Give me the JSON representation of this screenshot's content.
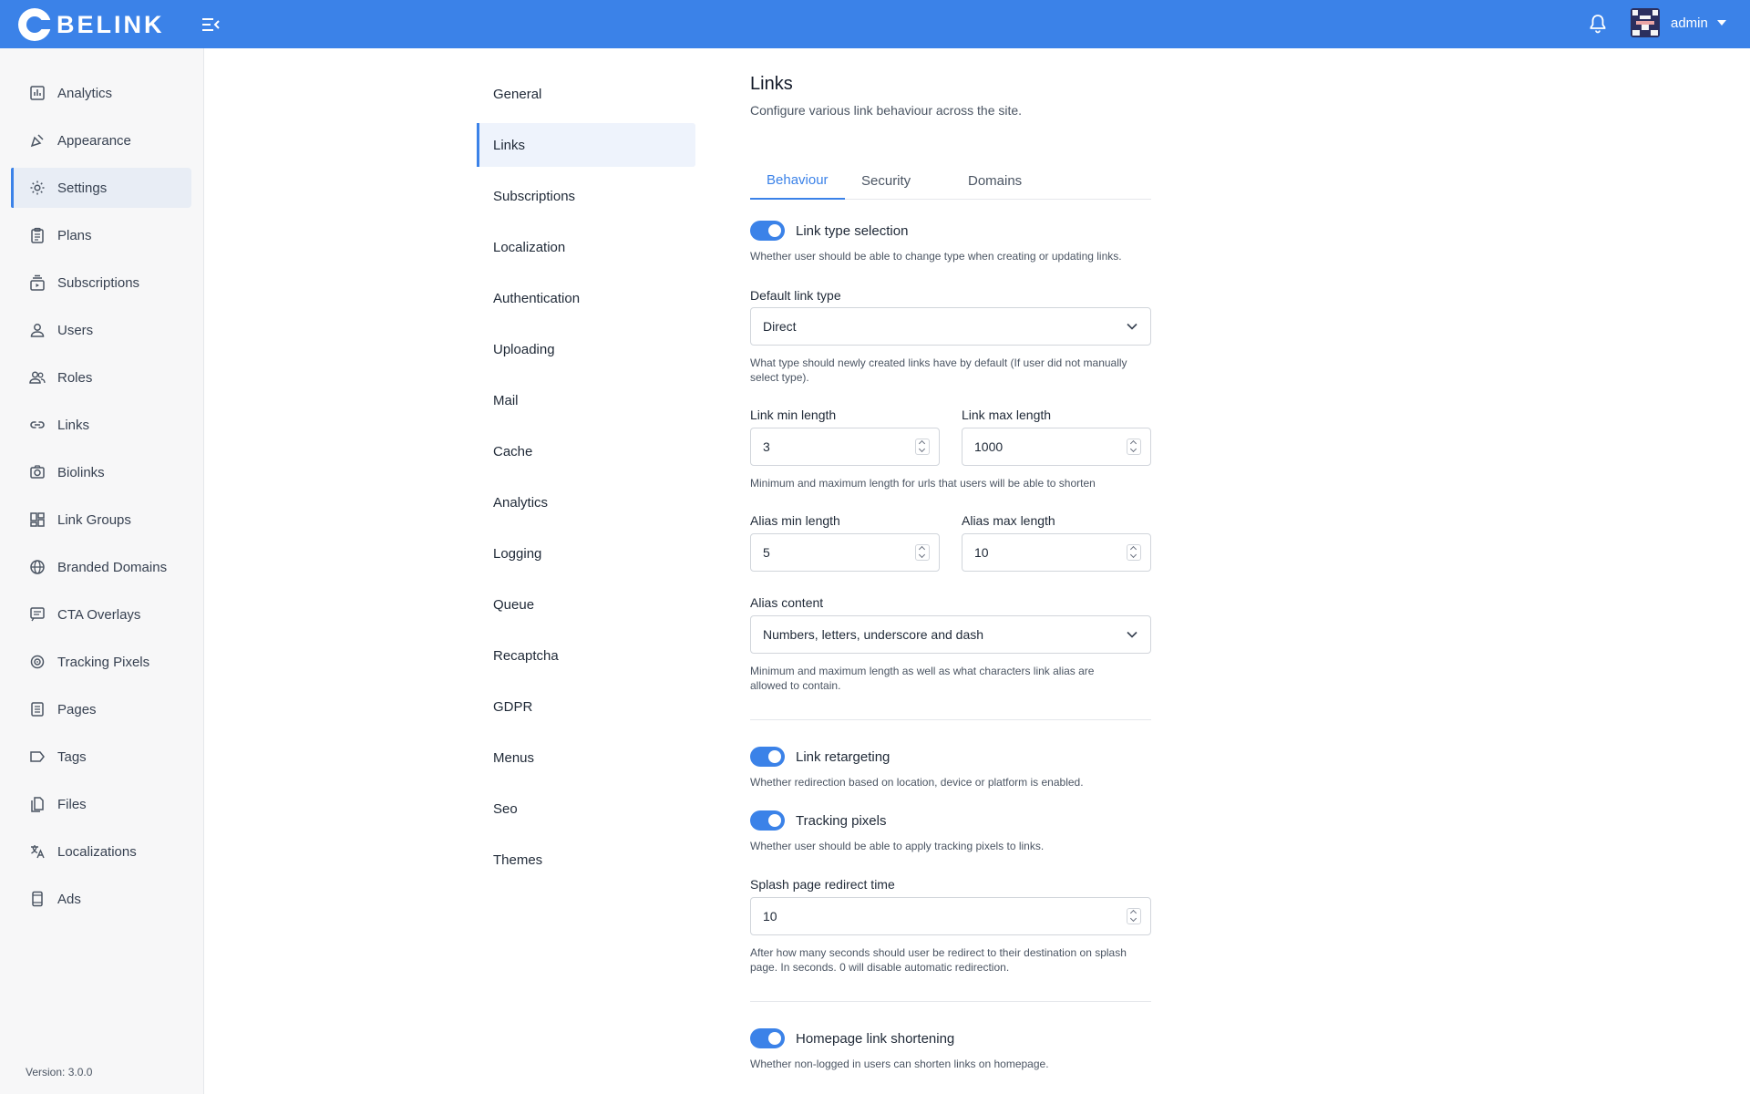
{
  "brand": {
    "name": "BELINK"
  },
  "topbar": {
    "user_name": "admin",
    "icons": [
      "menu-toggle-icon",
      "bell-icon",
      "avatar"
    ]
  },
  "sidebar": {
    "items": [
      {
        "label": "Analytics",
        "icon": "analytics-icon"
      },
      {
        "label": "Appearance",
        "icon": "appearance-icon"
      },
      {
        "label": "Settings",
        "icon": "gear-icon",
        "active": true
      },
      {
        "label": "Plans",
        "icon": "clipboard-icon"
      },
      {
        "label": "Subscriptions",
        "icon": "subscriptions-icon"
      },
      {
        "label": "Users",
        "icon": "user-icon"
      },
      {
        "label": "Roles",
        "icon": "people-icon"
      },
      {
        "label": "Links",
        "icon": "link-icon"
      },
      {
        "label": "Biolinks",
        "icon": "biolinks-icon"
      },
      {
        "label": "Link Groups",
        "icon": "dashboard-icon"
      },
      {
        "label": "Branded Domains",
        "icon": "globe-icon"
      },
      {
        "label": "CTA Overlays",
        "icon": "overlay-icon"
      },
      {
        "label": "Tracking Pixels",
        "icon": "pixel-icon"
      },
      {
        "label": "Pages",
        "icon": "pages-icon"
      },
      {
        "label": "Tags",
        "icon": "tag-icon"
      },
      {
        "label": "Files",
        "icon": "files-icon"
      },
      {
        "label": "Localizations",
        "icon": "translate-icon"
      },
      {
        "label": "Ads",
        "icon": "ads-icon"
      }
    ],
    "version": "Version: 3.0.0"
  },
  "settings_nav": {
    "items": [
      "General",
      "Links",
      "Subscriptions",
      "Localization",
      "Authentication",
      "Uploading",
      "Mail",
      "Cache",
      "Analytics",
      "Logging",
      "Queue",
      "Recaptcha",
      "GDPR",
      "Menus",
      "Seo",
      "Themes"
    ],
    "active": "Links"
  },
  "main": {
    "title": "Links",
    "subtitle": "Configure various link behaviour across the site.",
    "tabs": [
      "Behaviour",
      "Security",
      "Domains"
    ],
    "active_tab": "Behaviour",
    "link_type_selection": {
      "label": "Link type selection",
      "enabled": true,
      "hint": "Whether user should be able to change type when creating or updating links."
    },
    "default_link_type": {
      "label": "Default link type",
      "value": "Direct",
      "hint": "What type should newly created links have by default (If user did not manually select type)."
    },
    "link_min_length": {
      "label": "Link min length",
      "value": "3"
    },
    "link_max_length": {
      "label": "Link max length",
      "value": "1000"
    },
    "link_length_hint": "Minimum and maximum length for urls that users will be able to shorten",
    "alias_min_length": {
      "label": "Alias min length",
      "value": "5"
    },
    "alias_max_length": {
      "label": "Alias max length",
      "value": "10"
    },
    "alias_content": {
      "label": "Alias content",
      "value": "Numbers, letters, underscore and dash",
      "hint": "Minimum and maximum length as well as what characters link alias are allowed to contain."
    },
    "link_retargeting": {
      "label": "Link retargeting",
      "enabled": true,
      "hint": "Whether redirection based on location, device or platform is enabled."
    },
    "tracking_pixels": {
      "label": "Tracking pixels",
      "enabled": true,
      "hint": "Whether user should be able to apply tracking pixels to links."
    },
    "splash_redirect": {
      "label": "Splash page redirect time",
      "value": "10",
      "hint": "After how many seconds should user be redirect to their destination on splash page. In seconds. 0 will disable automatic redirection."
    },
    "homepage_shortening": {
      "label": "Homepage link shortening",
      "enabled": true,
      "hint": "Whether non-logged in users can shorten links on homepage."
    }
  },
  "colors": {
    "accent": "#3b82e8",
    "sidebar_bg": "#f7f7f8"
  }
}
